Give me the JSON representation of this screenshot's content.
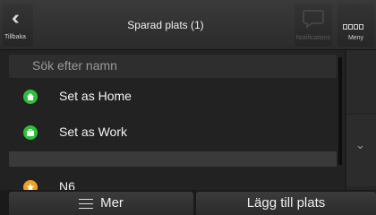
{
  "header": {
    "back_label": "Tillbaka",
    "title": "Sparad plats (1)",
    "notifications_label": "Notifications",
    "menu_label": "Meny"
  },
  "search": {
    "placeholder": "Sök efter namn"
  },
  "list": {
    "items": [
      {
        "label": "Set as Home",
        "icon": "home-icon",
        "icon_color": "#2fbf39"
      },
      {
        "label": "Set as Work",
        "icon": "briefcase-icon",
        "icon_color": "#2fbf39"
      },
      {
        "label": "N6",
        "icon": "star-icon",
        "icon_color": "#f0a020"
      }
    ]
  },
  "bottom": {
    "more_label": "Mer",
    "add_label": "Lägg till plats"
  }
}
